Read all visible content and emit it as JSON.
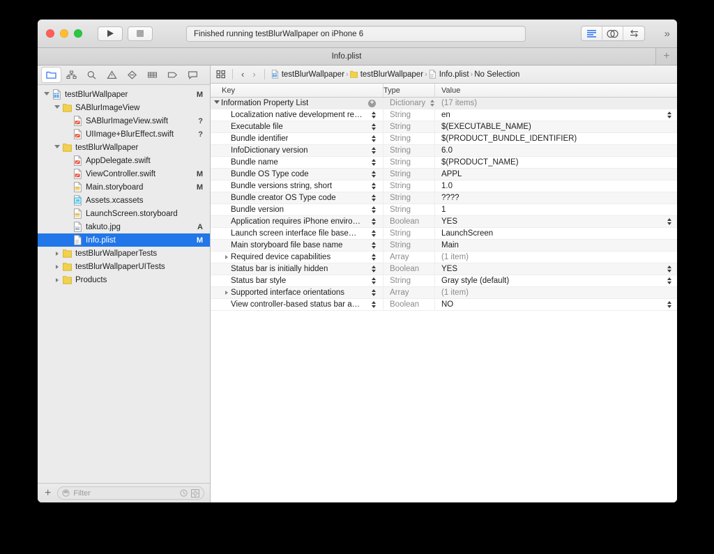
{
  "window": {
    "title": "Info.plist",
    "status_text": "Finished running testBlurWallpaper on iPhone 6",
    "traffic_lights": [
      "close-button",
      "minimize-button",
      "zoom-button"
    ],
    "run_label": "▶",
    "stop_label": "■",
    "more_label": "»",
    "tab_plus_label": "+"
  },
  "navigator": {
    "tabs": [
      {
        "name": "project-navigator",
        "icon": "folder-icon",
        "active": true
      },
      {
        "name": "source-control-navigator",
        "icon": "hierarchy-icon",
        "active": false
      },
      {
        "name": "symbol-navigator",
        "icon": "search-icon",
        "active": false
      },
      {
        "name": "issue-navigator",
        "icon": "warning-triangle-icon",
        "active": false
      },
      {
        "name": "test-navigator",
        "icon": "diamond-icon",
        "active": false
      },
      {
        "name": "debug-navigator",
        "icon": "grid-lines-icon",
        "active": false
      },
      {
        "name": "breakpoint-navigator",
        "icon": "breakpoint-tag-icon",
        "active": false
      },
      {
        "name": "report-navigator",
        "icon": "speech-bubble-icon",
        "active": false
      }
    ],
    "tree": [
      {
        "label": "testBlurWallpaper",
        "depth": 0,
        "disc": "open",
        "icon": "project-icon",
        "status": "M",
        "selected": false
      },
      {
        "label": "SABlurImageView",
        "depth": 1,
        "disc": "open",
        "icon": "folder-icon",
        "status": "",
        "selected": false
      },
      {
        "label": "SABlurImageView.swift",
        "depth": 2,
        "disc": "none",
        "icon": "swift-file-icon",
        "status": "?",
        "selected": false
      },
      {
        "label": "UIImage+BlurEffect.swift",
        "depth": 2,
        "disc": "none",
        "icon": "swift-file-icon",
        "status": "?",
        "selected": false
      },
      {
        "label": "testBlurWallpaper",
        "depth": 1,
        "disc": "open",
        "icon": "folder-icon",
        "status": "",
        "selected": false
      },
      {
        "label": "AppDelegate.swift",
        "depth": 2,
        "disc": "none",
        "icon": "swift-file-icon",
        "status": "",
        "selected": false
      },
      {
        "label": "ViewController.swift",
        "depth": 2,
        "disc": "none",
        "icon": "swift-file-icon",
        "status": "M",
        "selected": false
      },
      {
        "label": "Main.storyboard",
        "depth": 2,
        "disc": "none",
        "icon": "storyboard-icon",
        "status": "M",
        "selected": false
      },
      {
        "label": "Assets.xcassets",
        "depth": 2,
        "disc": "none",
        "icon": "xcassets-icon",
        "status": "",
        "selected": false
      },
      {
        "label": "LaunchScreen.storyboard",
        "depth": 2,
        "disc": "none",
        "icon": "storyboard-icon",
        "status": "",
        "selected": false
      },
      {
        "label": "takuto.jpg",
        "depth": 2,
        "disc": "none",
        "icon": "image-file-icon",
        "status": "A",
        "selected": false
      },
      {
        "label": "Info.plist",
        "depth": 2,
        "disc": "none",
        "icon": "plist-file-icon",
        "status": "M",
        "selected": true
      },
      {
        "label": "testBlurWallpaperTests",
        "depth": 1,
        "disc": "closed",
        "icon": "folder-icon",
        "status": "",
        "selected": false
      },
      {
        "label": "testBlurWallpaperUITests",
        "depth": 1,
        "disc": "closed",
        "icon": "folder-icon",
        "status": "",
        "selected": false
      },
      {
        "label": "Products",
        "depth": 1,
        "disc": "closed",
        "icon": "folder-icon",
        "status": "",
        "selected": false
      }
    ],
    "filter": {
      "add_label": "+",
      "placeholder": "Filter",
      "recent_icon": "clock-icon",
      "scope_icon": "target-icon"
    }
  },
  "editor": {
    "jumpbar": {
      "related_icon": "related-items-icon",
      "back_label": "‹",
      "forward_label": "›",
      "breadcrumbs": [
        {
          "label": "testBlurWallpaper",
          "icon": "project-icon"
        },
        {
          "label": "testBlurWallpaper",
          "icon": "folder-icon"
        },
        {
          "label": "Info.plist",
          "icon": "plist-file-icon"
        },
        {
          "label": "No Selection",
          "icon": ""
        }
      ],
      "separator": "›"
    },
    "table": {
      "columns": [
        "Key",
        "Type",
        "Value"
      ],
      "rows": [
        {
          "key": "Information Property List",
          "depth": 0,
          "disc": "open",
          "type": "Dictionary",
          "value": "(17 items)",
          "muted": true,
          "add": true,
          "key_stepper": false,
          "type_chevron": true,
          "value_stepper": false
        },
        {
          "key": "Localization native development re…",
          "depth": 1,
          "disc": "none",
          "type": "String",
          "value": "en",
          "muted": false,
          "add": false,
          "key_stepper": true,
          "type_chevron": false,
          "value_stepper": true
        },
        {
          "key": "Executable file",
          "depth": 1,
          "disc": "none",
          "type": "String",
          "value": "$(EXECUTABLE_NAME)",
          "muted": false,
          "add": false,
          "key_stepper": true,
          "type_chevron": false,
          "value_stepper": false
        },
        {
          "key": "Bundle identifier",
          "depth": 1,
          "disc": "none",
          "type": "String",
          "value": "$(PRODUCT_BUNDLE_IDENTIFIER)",
          "muted": false,
          "add": false,
          "key_stepper": true,
          "type_chevron": false,
          "value_stepper": false
        },
        {
          "key": "InfoDictionary version",
          "depth": 1,
          "disc": "none",
          "type": "String",
          "value": "6.0",
          "muted": false,
          "add": false,
          "key_stepper": true,
          "type_chevron": false,
          "value_stepper": false
        },
        {
          "key": "Bundle name",
          "depth": 1,
          "disc": "none",
          "type": "String",
          "value": "$(PRODUCT_NAME)",
          "muted": false,
          "add": false,
          "key_stepper": true,
          "type_chevron": false,
          "value_stepper": false
        },
        {
          "key": "Bundle OS Type code",
          "depth": 1,
          "disc": "none",
          "type": "String",
          "value": "APPL",
          "muted": false,
          "add": false,
          "key_stepper": true,
          "type_chevron": false,
          "value_stepper": false
        },
        {
          "key": "Bundle versions string, short",
          "depth": 1,
          "disc": "none",
          "type": "String",
          "value": "1.0",
          "muted": false,
          "add": false,
          "key_stepper": true,
          "type_chevron": false,
          "value_stepper": false
        },
        {
          "key": "Bundle creator OS Type code",
          "depth": 1,
          "disc": "none",
          "type": "String",
          "value": "????",
          "muted": false,
          "add": false,
          "key_stepper": true,
          "type_chevron": false,
          "value_stepper": false
        },
        {
          "key": "Bundle version",
          "depth": 1,
          "disc": "none",
          "type": "String",
          "value": "1",
          "muted": false,
          "add": false,
          "key_stepper": true,
          "type_chevron": false,
          "value_stepper": false
        },
        {
          "key": "Application requires iPhone enviro…",
          "depth": 1,
          "disc": "none",
          "type": "Boolean",
          "value": "YES",
          "muted": false,
          "add": false,
          "key_stepper": true,
          "type_chevron": false,
          "value_stepper": true
        },
        {
          "key": "Launch screen interface file base…",
          "depth": 1,
          "disc": "none",
          "type": "String",
          "value": "LaunchScreen",
          "muted": false,
          "add": false,
          "key_stepper": true,
          "type_chevron": false,
          "value_stepper": false
        },
        {
          "key": "Main storyboard file base name",
          "depth": 1,
          "disc": "none",
          "type": "String",
          "value": "Main",
          "muted": false,
          "add": false,
          "key_stepper": true,
          "type_chevron": false,
          "value_stepper": false
        },
        {
          "key": "Required device capabilities",
          "depth": 1,
          "disc": "closed",
          "type": "Array",
          "value": "(1 item)",
          "muted": true,
          "add": false,
          "key_stepper": true,
          "type_chevron": false,
          "value_stepper": false
        },
        {
          "key": "Status bar is initially hidden",
          "depth": 1,
          "disc": "none",
          "type": "Boolean",
          "value": "YES",
          "muted": false,
          "add": false,
          "key_stepper": true,
          "type_chevron": false,
          "value_stepper": true
        },
        {
          "key": "Status bar style",
          "depth": 1,
          "disc": "none",
          "type": "String",
          "value": "Gray style (default)",
          "muted": false,
          "add": false,
          "key_stepper": true,
          "type_chevron": false,
          "value_stepper": true
        },
        {
          "key": "Supported interface orientations",
          "depth": 1,
          "disc": "closed",
          "type": "Array",
          "value": "(1 item)",
          "muted": true,
          "add": false,
          "key_stepper": true,
          "type_chevron": false,
          "value_stepper": false
        },
        {
          "key": "View controller-based status bar a…",
          "depth": 1,
          "disc": "none",
          "type": "Boolean",
          "value": "NO",
          "muted": false,
          "add": false,
          "key_stepper": true,
          "type_chevron": false,
          "value_stepper": true
        }
      ]
    }
  },
  "colors": {
    "selection_blue": "#2176e8",
    "accent_blue": "#3478f6",
    "folder_yellow": "#f2d14b",
    "window_chrome": "#ececec",
    "navigator_bg": "#ebebeb"
  }
}
